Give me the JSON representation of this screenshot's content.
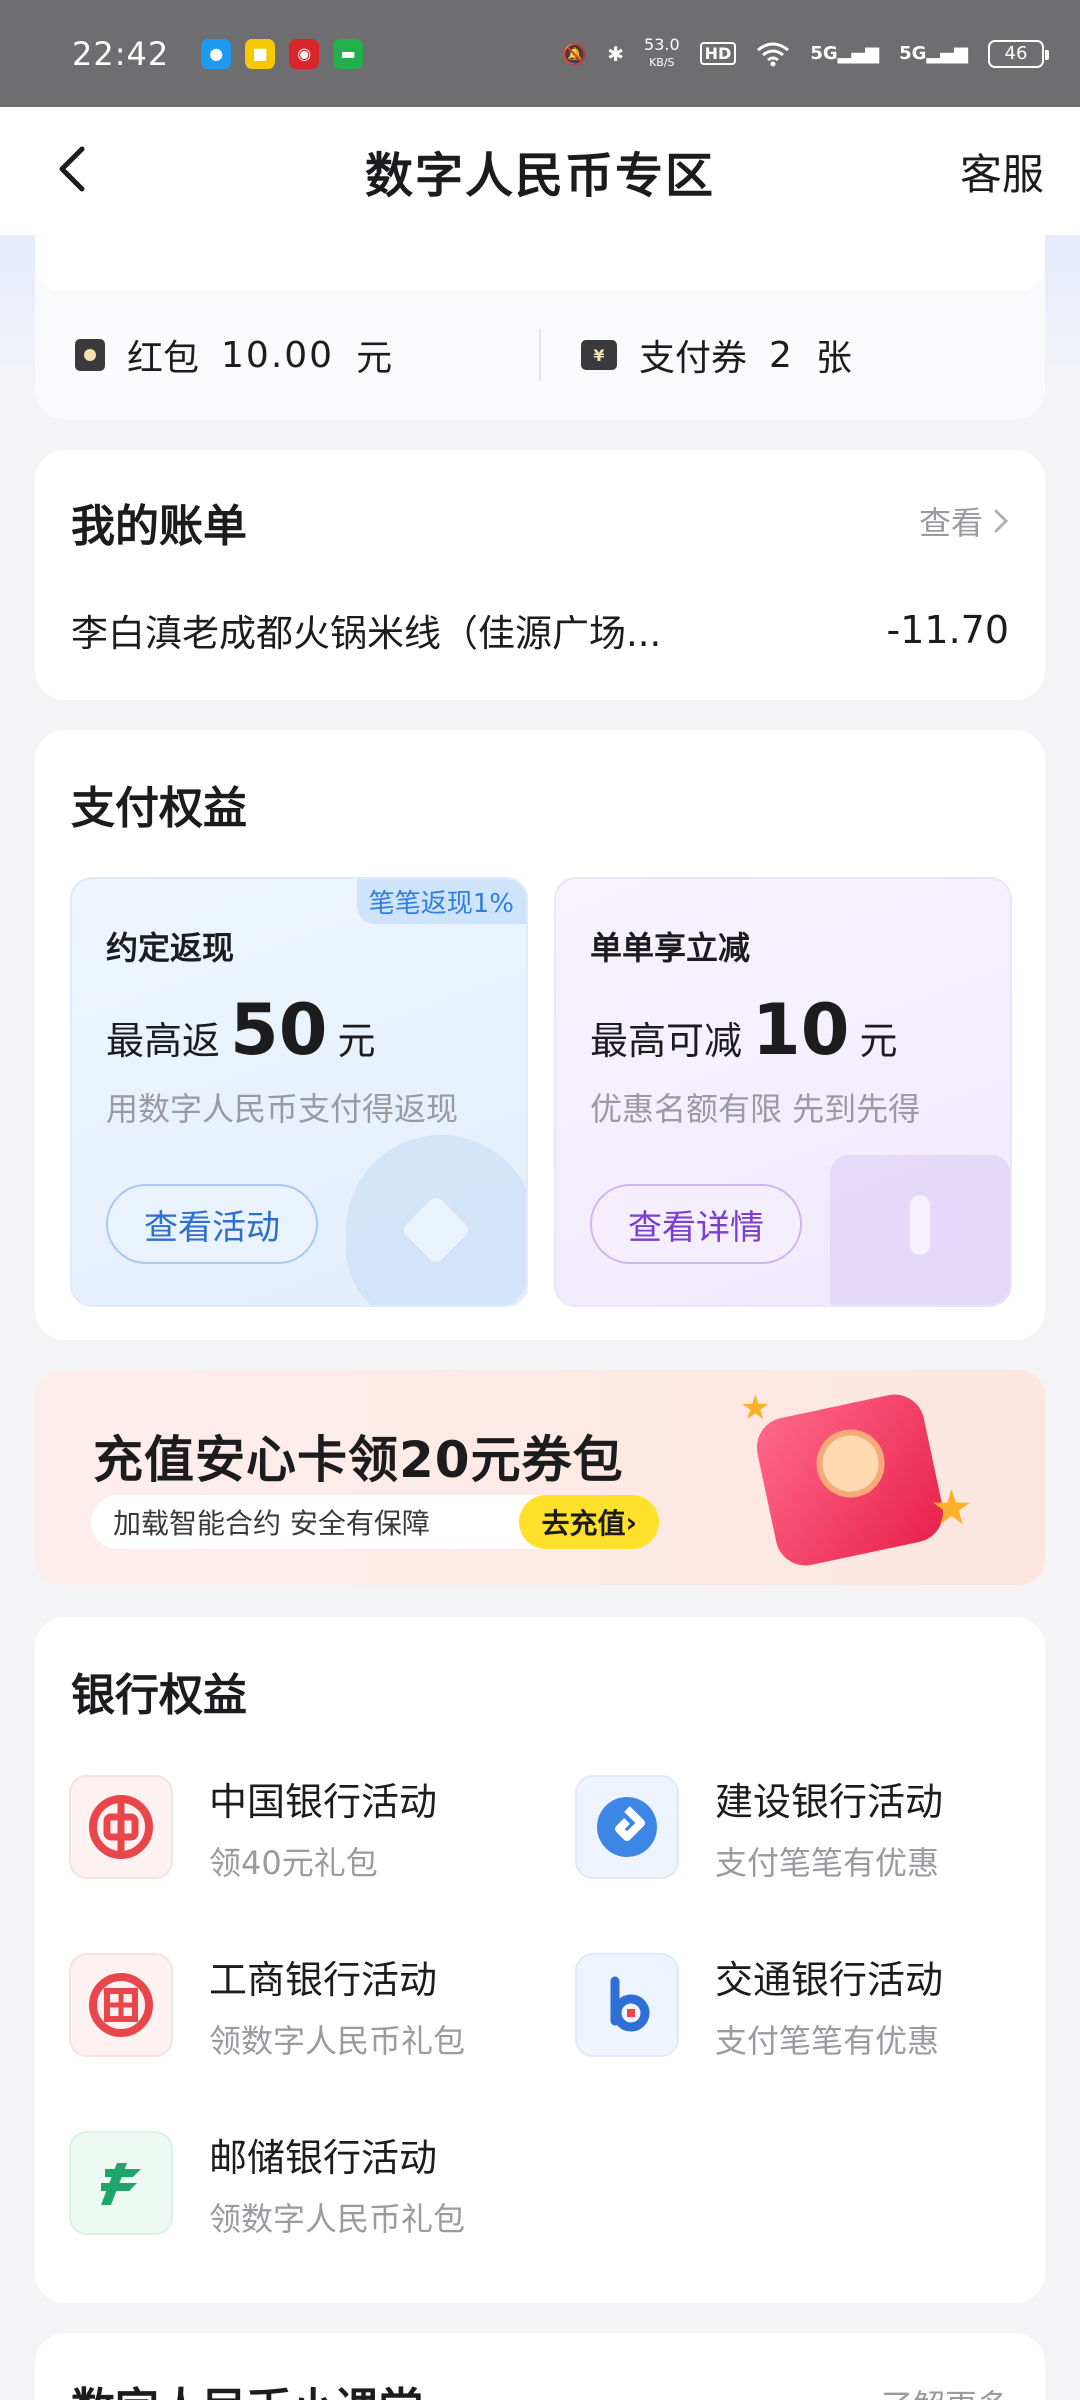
{
  "status_bar": {
    "time": "22:42",
    "speed_value": "53.0",
    "speed_unit": "KB/S",
    "hd": "HD",
    "net1": "5G",
    "net2": "5G",
    "battery": "46"
  },
  "nav": {
    "title": "数字人民币专区",
    "service": "客服"
  },
  "balance": {
    "red_packet_label": "红包",
    "red_packet_value": "10.00",
    "red_packet_unit": "元",
    "coupon_label": "支付券",
    "coupon_value": "2",
    "coupon_unit": "张"
  },
  "bill": {
    "title": "我的账单",
    "view": "查看",
    "merchant": "李白滇老成都火锅米线（佳源广场...",
    "amount": "-11.70"
  },
  "pay_benefits": {
    "title": "支付权益",
    "cards": [
      {
        "tag": "笔笔返现1%",
        "head": "约定返现",
        "prefix": "最高返",
        "number": "50",
        "unit": "元",
        "sub": "用数字人民币支付得返现",
        "button": "查看活动"
      },
      {
        "head": "单单享立减",
        "prefix": "最高可减",
        "number": "10",
        "unit": "元",
        "sub": "优惠名额有限 先到先得",
        "button": "查看详情"
      }
    ]
  },
  "banner": {
    "title": "充值安心卡领20元券包",
    "subtitle": "加载智能合约 安全有保障",
    "action": "去充值"
  },
  "bank_benefits": {
    "title": "银行权益",
    "items": [
      {
        "name": "中国银行活动",
        "desc": "领40元礼包",
        "icon": "boc-logo-icon"
      },
      {
        "name": "建设银行活动",
        "desc": "支付笔笔有优惠",
        "icon": "ccb-logo-icon"
      },
      {
        "name": "工商银行活动",
        "desc": "领数字人民币礼包",
        "icon": "icbc-logo-icon"
      },
      {
        "name": "交通银行活动",
        "desc": "支付笔笔有优惠",
        "icon": "bocom-logo-icon"
      },
      {
        "name": "邮储银行活动",
        "desc": "领数字人民币礼包",
        "icon": "psbc-logo-icon"
      }
    ]
  },
  "next_section": {
    "title": "数字人民币小课堂",
    "more": "了解更多"
  },
  "colors": {
    "accent_blue": "#2b6fcf",
    "accent_purple": "#7a3fcf",
    "banner_button": "#ffe02a",
    "boc_red": "#e8464a",
    "ccb_blue": "#3d86e6",
    "psbc_green": "#1fa46a"
  }
}
